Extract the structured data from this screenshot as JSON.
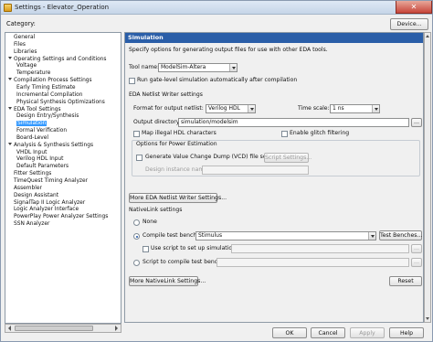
{
  "window": {
    "title": "Settings - Elevator_Operation",
    "close_glyph": "✕"
  },
  "header": {
    "category_label": "Category:",
    "device_button": "Device..."
  },
  "tree": [
    {
      "label": "General",
      "level": 0,
      "expander": false
    },
    {
      "label": "Files",
      "level": 0,
      "expander": false
    },
    {
      "label": "Libraries",
      "level": 0,
      "expander": false
    },
    {
      "label": "Operating Settings and Conditions",
      "level": 0,
      "expander": true
    },
    {
      "label": "Voltage",
      "level": 1,
      "expander": false
    },
    {
      "label": "Temperature",
      "level": 1,
      "expander": false
    },
    {
      "label": "Compilation Process Settings",
      "level": 0,
      "expander": true
    },
    {
      "label": "Early Timing Estimate",
      "level": 1,
      "expander": false
    },
    {
      "label": "Incremental Compilation",
      "level": 1,
      "expander": false
    },
    {
      "label": "Physical Synthesis Optimizations",
      "level": 1,
      "expander": false
    },
    {
      "label": "EDA Tool Settings",
      "level": 0,
      "expander": true
    },
    {
      "label": "Design Entry/Synthesis",
      "level": 1,
      "expander": false
    },
    {
      "label": "Simulation",
      "level": 1,
      "expander": false,
      "selected": true
    },
    {
      "label": "Formal Verification",
      "level": 1,
      "expander": false
    },
    {
      "label": "Board-Level",
      "level": 1,
      "expander": false
    },
    {
      "label": "Analysis & Synthesis Settings",
      "level": 0,
      "expander": true
    },
    {
      "label": "VHDL Input",
      "level": 1,
      "expander": false
    },
    {
      "label": "Verilog HDL Input",
      "level": 1,
      "expander": false
    },
    {
      "label": "Default Parameters",
      "level": 1,
      "expander": false
    },
    {
      "label": "Fitter Settings",
      "level": 0,
      "expander": false
    },
    {
      "label": "TimeQuest Timing Analyzer",
      "level": 0,
      "expander": false
    },
    {
      "label": "Assembler",
      "level": 0,
      "expander": false
    },
    {
      "label": "Design Assistant",
      "level": 0,
      "expander": false
    },
    {
      "label": "SignalTap II Logic Analyzer",
      "level": 0,
      "expander": false
    },
    {
      "label": "Logic Analyzer Interface",
      "level": 0,
      "expander": false
    },
    {
      "label": "PowerPlay Power Analyzer Settings",
      "level": 0,
      "expander": false
    },
    {
      "label": "SSN Analyzer",
      "level": 0,
      "expander": false
    }
  ],
  "panel": {
    "header": "Simulation",
    "description": "Specify options for generating output files for use with other EDA tools.",
    "tool_name_label": "Tool name:",
    "tool_name_value": "ModelSim-Altera",
    "run_gate_level": "Run gate-level simulation automatically after compilation",
    "netlist_section": "EDA Netlist Writer settings",
    "format_label": "Format for output netlist:",
    "format_value": "Verilog HDL",
    "time_scale_label": "Time scale:",
    "time_scale_value": "1 ns",
    "output_dir_label": "Output directory:",
    "output_dir_value": "simulation/modelsim",
    "browse_label": "...",
    "map_illegal": "Map illegal HDL characters",
    "enable_glitch": "Enable glitch filtering",
    "power_section": "Options for Power Estimation",
    "gen_vcd": "Generate Value Change Dump (VCD) file script",
    "script_settings": "Script Settings...",
    "design_instance_label": "Design instance name:",
    "more_netlist": "More EDA Netlist Writer Settings...",
    "nativelink_section": "NativeLink settings",
    "none_label": "None",
    "compile_tb_label": "Compile test bench:",
    "compile_tb_value": "Stimulus",
    "test_benches": "Test Benches...",
    "use_script_label": "Use script to set up simulation:",
    "script_compile_label": "Script to compile test bench:",
    "more_nativelink": "More NativeLink Settings...",
    "reset": "Reset"
  },
  "footer": {
    "ok": "OK",
    "cancel": "Cancel",
    "apply": "Apply",
    "help": "Help"
  },
  "colors": {
    "header_bg": "#2a5ea8",
    "selection": "#3399ff"
  }
}
